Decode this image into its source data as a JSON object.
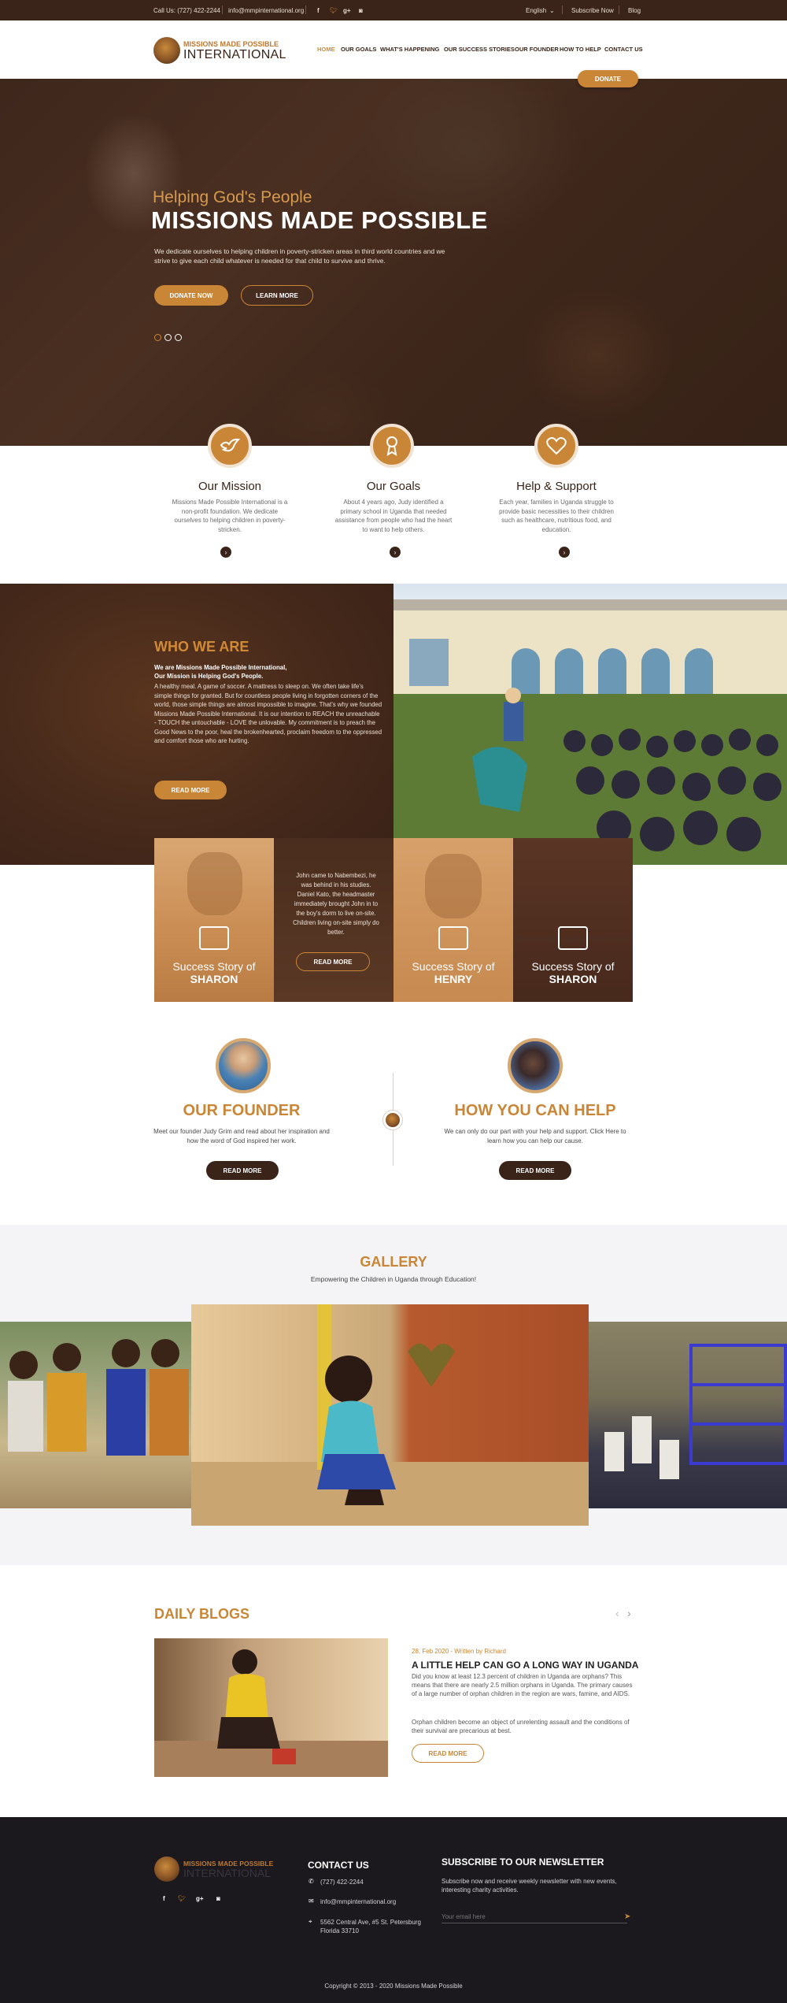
{
  "topbar": {
    "call": "Call Us: (727) 422-2244",
    "email": "info@mmpinternational.org",
    "language": "English",
    "subscribe": "Subscribe Now",
    "blog": "Blog"
  },
  "header": {
    "logo_line1": "MISSIONS MADE POSSIBLE",
    "logo_line2": "INTERNATIONAL",
    "nav": [
      "HOME",
      "OUR GOALS",
      "WHAT'S HAPPENING",
      "OUR SUCCESS STORIES",
      "OUR FOUNDER",
      "HOW TO HELP",
      "CONTACT US"
    ],
    "donate": "DONATE"
  },
  "hero": {
    "subtitle": "Helping God's People",
    "title": "MISSIONS MADE POSSIBLE",
    "text": "We dedicate ourselves to helping children in poverty-stricken areas in third world countries and we strive to give each child whatever is needed for that child to survive and thrive.",
    "donate_btn": "DONATE NOW",
    "learn_btn": "LEARN MORE"
  },
  "features": [
    {
      "title": "Our Mission",
      "text": "Missions Made Possible International is a non-profit foundation. We dedicate ourselves to helping children in poverty-stricken.",
      "icon": "dove-icon"
    },
    {
      "title": "Our Goals",
      "text": "About 4 years ago, Judy identified a primary school in Uganda that needed assistance from people who had the heart to want to help others.",
      "icon": "ribbon-icon"
    },
    {
      "title": "Help & Support",
      "text": "Each year, families in Uganda struggle to provide basic necessities to their children such as healthcare, nutritious food, and education.",
      "icon": "heart-icon"
    }
  ],
  "who": {
    "title": "WHO WE ARE",
    "strong1": "We are Missions Made Possible International,",
    "strong2": "Our Mission is Helping God's People.",
    "text": "A healthy meal. A game of soccer. A mattress to sleep on. We often take life's simple things for granted. But for countless people living in forgotten corners of the world, those simple things are almost impossible to imagine. That's why we founded Missions Made Possible International. It is our intention to REACH the unreachable - TOUCH the untouchable - LOVE the unlovable. My commitment is to preach the Good News to the poor, heal the brokenhearted, proclaim freedom to the oppressed and comfort those who are hurting.",
    "btn": "READ MORE"
  },
  "stories": {
    "prefix": "Success Story of",
    "names": [
      "SHARON",
      "HENRY",
      "SHARON"
    ],
    "john_text": "John came to Nabembezi, he was behind in his studies. Daniel Kato, the headmaster immediately brought John in to the boy's dorm to live on-site. Children living on-site simply do better.",
    "read_more": "READ MORE"
  },
  "founder": {
    "title": "OUR FOUNDER",
    "text": "Meet our founder Judy Grim and read about her inspiration and how the word of God inspired her work.",
    "btn": "READ MORE"
  },
  "help": {
    "title": "HOW YOU CAN HELP",
    "text": "We can only do our part with your help and support. Click Here to learn how you can help our cause.",
    "btn": "READ MORE"
  },
  "gallery": {
    "title": "GALLERY",
    "subtitle": "Empowering the Children in Uganda through Education!"
  },
  "blogs": {
    "title": "DAILY BLOGS",
    "date": "28, Feb 2020",
    "author": "- Written by Richard",
    "post_title": "A LITTLE HELP CAN GO A LONG WAY IN UGANDA",
    "p1": "Did you know at least 12.3 percent of children in Uganda are orphans? This means that there are nearly 2.5 million orphans in Uganda. The primary causes of a large number of orphan children in the region are wars, famine, and AIDS.",
    "p2": "Orphan children become an object of unrelenting assault and the conditions of their survival are precarious at best.",
    "btn": "READ MORE"
  },
  "footer": {
    "logo_line1": "MISSIONS MADE POSSIBLE",
    "logo_line2": "INTERNATIONAL",
    "contact_title": "CONTACT US",
    "phone": "(727) 422-2244",
    "email": "info@mmpinternational.org",
    "address1": "5562 Central Ave, #5 St. Petersburg",
    "address2": "Florida  33710",
    "news_title": "SUBSCRIBE TO OUR NEWSLETTER",
    "news_text": "Subscribe now and receive weekly newsletter with new events, interesting charity activities.",
    "email_placeholder": "Your email here",
    "copyright": "Copyright © 2013 - 2020 Missions Made Possible"
  },
  "colors": {
    "accent": "#c98636",
    "dark_brown": "#3a2419",
    "footer": "#1b191d"
  }
}
